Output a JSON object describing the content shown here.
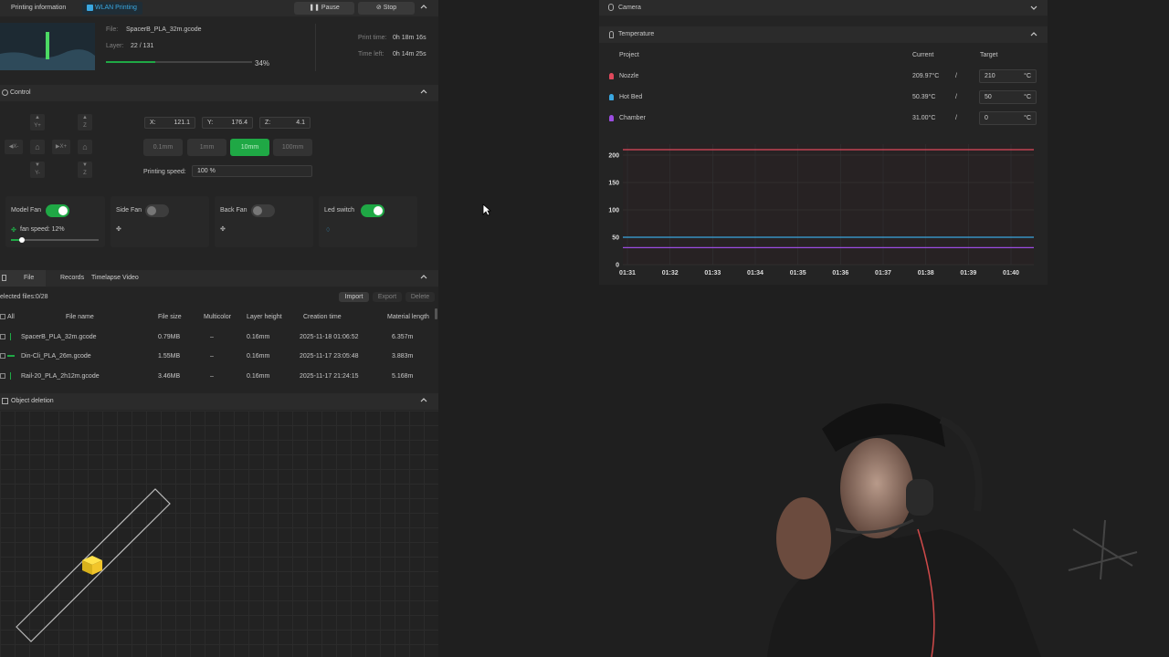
{
  "print_info": {
    "title": "Printing information",
    "wlan_badge": "WLAN Printing",
    "pause_label": "Pause",
    "stop_label": "Stop",
    "file_label": "File:",
    "file_value": "SpacerB_PLA_32m.gcode",
    "layer_label": "Layer:",
    "layer_value": "22 / 131",
    "progress_text": "34%",
    "progress": 0.34,
    "print_time_label": "Print time:",
    "print_time_value": "0h 18m 16s",
    "time_left_label": "Time left:",
    "time_left_value": "0h 14m 25s"
  },
  "control": {
    "title": "Control",
    "jog": {
      "yplus": "Y+",
      "yminus": "Y-",
      "xminus": "X-",
      "xplus": "X+",
      "zup": "Z",
      "zdown": "Z"
    },
    "x_label": "X:",
    "x_value": "121.1",
    "y_label": "Y:",
    "y_value": "176.4",
    "z_label": "Z:",
    "z_value": "4.1",
    "steps": [
      "0.1mm",
      "1mm",
      "10mm",
      "100mm"
    ],
    "active_step": "10mm",
    "speed_label": "Printing speed:",
    "speed_value": "100 %",
    "fans": {
      "model_fan": "Model Fan",
      "fan_speed": "fan speed: 12%",
      "fan_speed_fraction": 0.12,
      "side_fan": "Side Fan",
      "back_fan": "Back Fan",
      "led_switch": "Led switch"
    }
  },
  "files": {
    "tabs": [
      "File",
      "Records",
      "Timelapse Video"
    ],
    "selected": "elected files:0/28",
    "import_label": "Import",
    "export_label": "Export",
    "delete_label": "Delete",
    "columns": [
      "All",
      "File name",
      "File size",
      "Multicolor",
      "Layer height",
      "Creation time",
      "Material length"
    ],
    "rows": [
      {
        "name": "SpacerB_PLA_32m.gcode",
        "size": "0.79MB",
        "multicolor": "–",
        "layer": "0.16mm",
        "created": "2025-11-18 01:06:52",
        "length": "6.357m"
      },
      {
        "name": "Din-Cli_PLA_26m.gcode",
        "size": "1.55MB",
        "multicolor": "–",
        "layer": "0.16mm",
        "created": "2025-11-17 23:05:48",
        "length": "3.883m"
      },
      {
        "name": "Rail-20_PLA_2h12m.gcode",
        "size": "3.46MB",
        "multicolor": "–",
        "layer": "0.16mm",
        "created": "2025-11-17 21:24:15",
        "length": "5.168m"
      }
    ]
  },
  "object_deletion": {
    "title": "Object deletion"
  },
  "camera": {
    "title": "Camera"
  },
  "temperature": {
    "title": "Temperature",
    "col_project": "Project",
    "col_current": "Current",
    "col_target": "Target",
    "unit": "°C",
    "sep": "/",
    "rows": [
      {
        "name": "Nozzle",
        "current": "209.97°C",
        "target": "210",
        "color": "#e0495c"
      },
      {
        "name": "Hot Bed",
        "current": "50.39°C",
        "target": "50",
        "color": "#3aa7e0"
      },
      {
        "name": "Chamber",
        "current": "31.00°C",
        "target": "0",
        "color": "#9b4ce0"
      }
    ]
  },
  "chart_data": {
    "type": "line",
    "x": [
      "01:31",
      "01:32",
      "01:33",
      "01:34",
      "01:35",
      "01:36",
      "01:37",
      "01:38",
      "01:39",
      "01:40"
    ],
    "ylim": [
      0,
      220
    ],
    "yticks": [
      0,
      50,
      100,
      150,
      200
    ],
    "series": [
      {
        "name": "Nozzle",
        "color": "#e0495c",
        "values": [
          210,
          210,
          210,
          210,
          210,
          210,
          210,
          210,
          210,
          210
        ]
      },
      {
        "name": "Hot Bed",
        "color": "#3aa7e0",
        "values": [
          50,
          50,
          50,
          50,
          50,
          50,
          50,
          50,
          50,
          50
        ]
      },
      {
        "name": "Chamber",
        "color": "#9b4ce0",
        "values": [
          31,
          31,
          31,
          31,
          31,
          31,
          31,
          31,
          31,
          31
        ]
      }
    ]
  }
}
